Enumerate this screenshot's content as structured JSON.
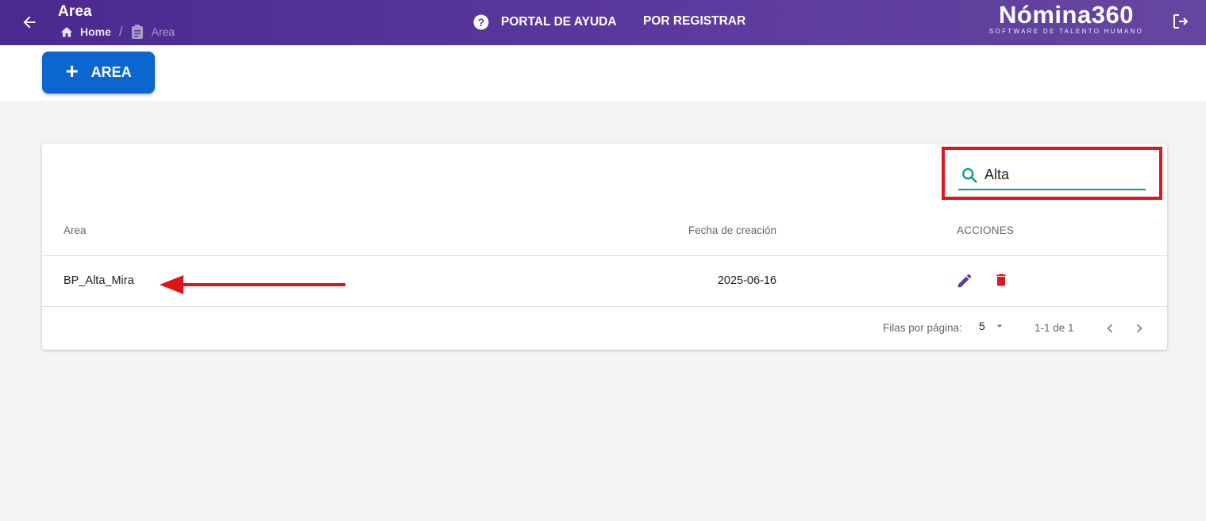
{
  "header": {
    "title": "Area",
    "breadcrumb": {
      "home": "Home",
      "current": "Area"
    },
    "nav": {
      "help": "PORTAL DE AYUDA",
      "register": "POR REGISTRAR"
    },
    "brand": {
      "name": "Nómina360",
      "tagline": "SOFTWARE DE TALENTO HUMANO"
    },
    "icons": {
      "back": "arrow-left-icon",
      "home": "home-icon",
      "current": "clipboard-icon",
      "help": "help-circle-icon",
      "logout": "logout-icon"
    },
    "colors": {
      "bar_start": "#4a2a8e",
      "bar_end": "#65469f"
    }
  },
  "toolbar": {
    "add_label": "AREA",
    "add_icon": "plus-icon",
    "add_color": "#0b66d0"
  },
  "search": {
    "value": "Alta",
    "icon": "search-icon",
    "underline_color": "#139a8d",
    "highlight_color": "#e0141c"
  },
  "table": {
    "columns": [
      "Area",
      "Fecha de creación",
      "ACCIONES"
    ],
    "rows": [
      {
        "area": "BP_Alta_Mira",
        "fecha": "2025-06-16",
        "actions": [
          "edit-icon",
          "delete-icon"
        ]
      }
    ],
    "action_colors": {
      "edit": "#5b3aa8",
      "delete": "#e0141c"
    },
    "annotation": {
      "arrow_color": "#e0141c"
    }
  },
  "pagination": {
    "rows_per_page_label": "Filas por página:",
    "rows_per_page": "5",
    "range": "1-1 de 1"
  }
}
